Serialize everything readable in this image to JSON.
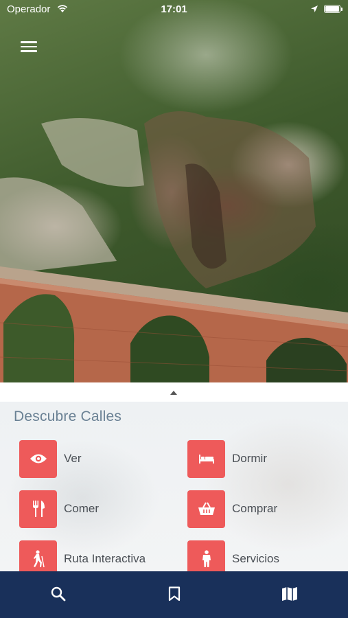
{
  "status_bar": {
    "carrier": "Operador",
    "time": "17:01"
  },
  "panel": {
    "title": "Descubre Calles",
    "items": [
      {
        "label": "Ver",
        "icon": "eye-icon"
      },
      {
        "label": "Dormir",
        "icon": "bed-icon"
      },
      {
        "label": "Comer",
        "icon": "cutlery-icon"
      },
      {
        "label": "Comprar",
        "icon": "basket-icon"
      },
      {
        "label": "Ruta Interactiva",
        "icon": "hiker-icon"
      },
      {
        "label": "Servicios",
        "icon": "person-icon"
      }
    ]
  },
  "tab_bar": {
    "tabs": [
      "search-icon",
      "bookmark-icon",
      "map-icon"
    ]
  },
  "colors": {
    "accent": "#ee5a5a",
    "tab_bar": "#19305a",
    "title": "#6a8194"
  }
}
